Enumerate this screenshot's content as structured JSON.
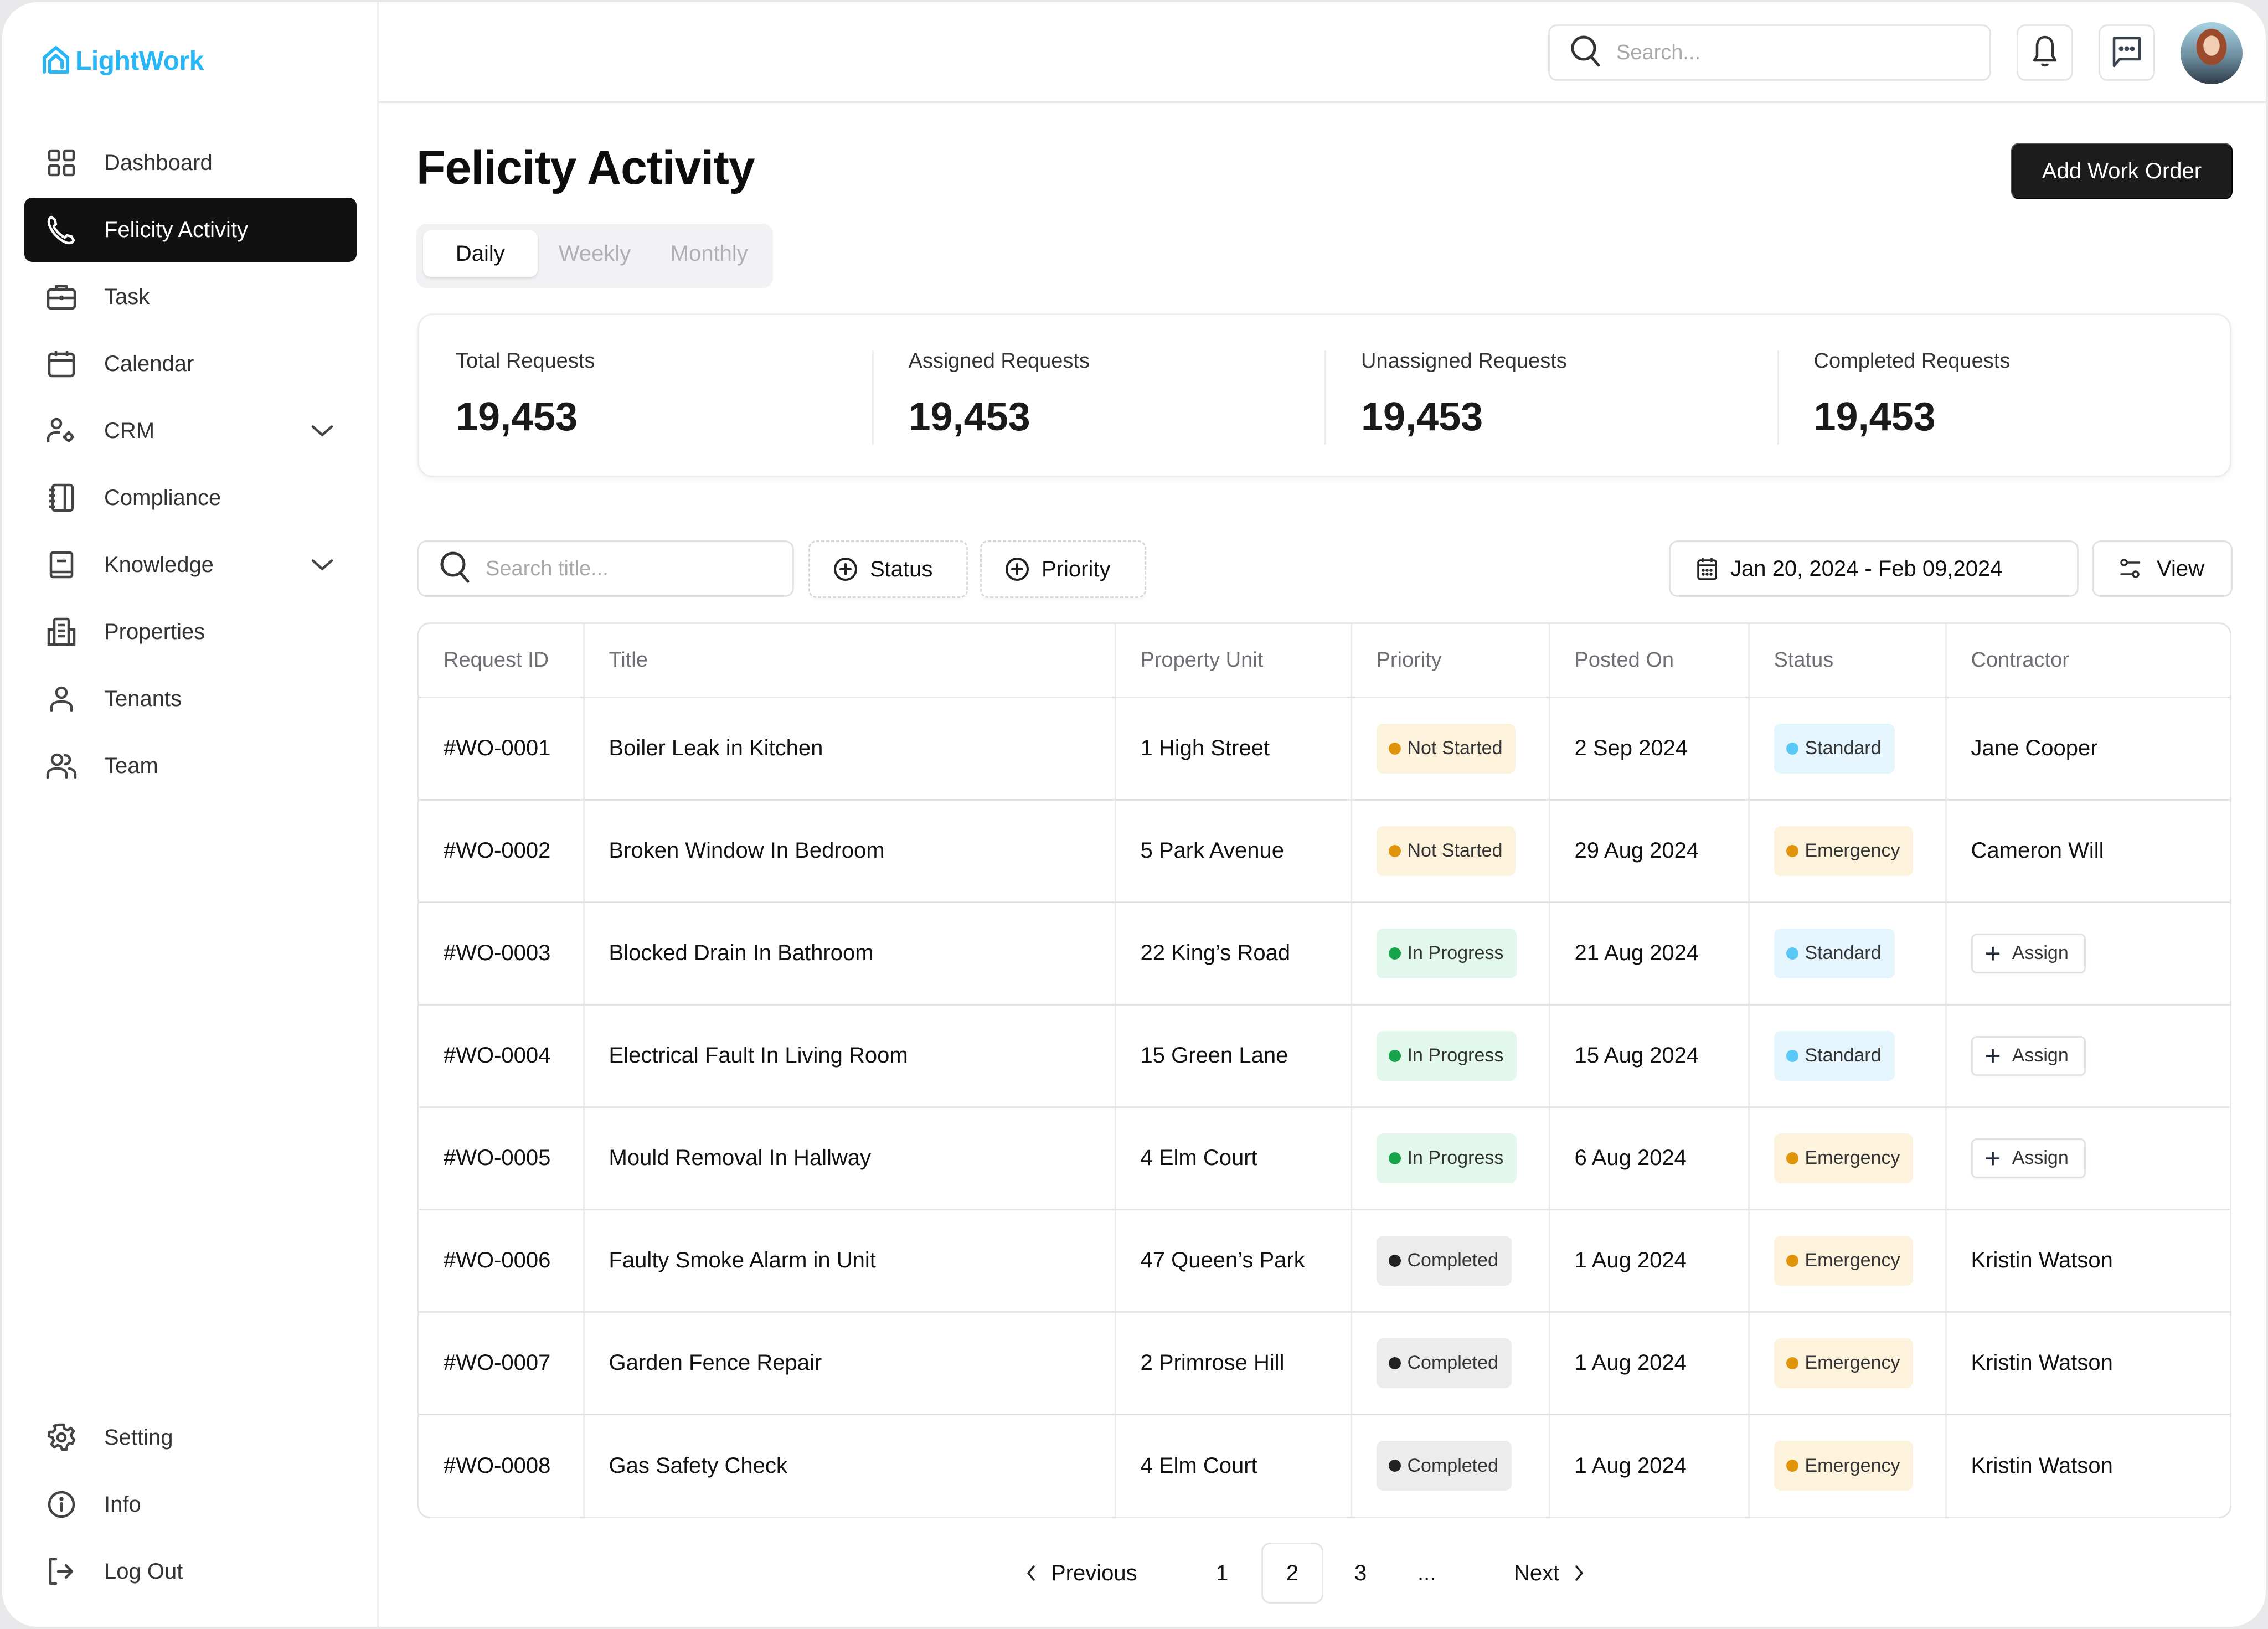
{
  "app": {
    "name": "LightWork",
    "brand_color": "#29b6f6"
  },
  "sidebar": {
    "items": [
      {
        "label": "Dashboard",
        "icon": "grid-icon",
        "active": false
      },
      {
        "label": "Felicity Activity",
        "icon": "phone-icon",
        "active": true
      },
      {
        "label": "Task",
        "icon": "briefcase-icon",
        "active": false
      },
      {
        "label": "Calendar",
        "icon": "calendar-icon",
        "active": false
      },
      {
        "label": "CRM",
        "icon": "user-gear-icon",
        "active": false,
        "expandable": true
      },
      {
        "label": "Compliance",
        "icon": "notebook-icon",
        "active": false
      },
      {
        "label": "Knowledge",
        "icon": "book-icon",
        "active": false,
        "expandable": true
      },
      {
        "label": "Properties",
        "icon": "building-icon",
        "active": false
      },
      {
        "label": "Tenants",
        "icon": "user-icon",
        "active": false
      },
      {
        "label": "Team",
        "icon": "users-icon",
        "active": false
      }
    ],
    "bottom_items": [
      {
        "label": "Setting",
        "icon": "gear-icon"
      },
      {
        "label": "Info",
        "icon": "info-icon"
      },
      {
        "label": "Log Out",
        "icon": "logout-icon"
      }
    ]
  },
  "topbar": {
    "search_placeholder": "Search...",
    "notification_icon": "bell-icon",
    "message_icon": "chat-icon",
    "avatar": "user-avatar"
  },
  "page": {
    "title": "Felicity Activity",
    "add_button": "Add Work Order",
    "tabs": [
      {
        "label": "Daily",
        "active": true
      },
      {
        "label": "Weekly",
        "active": false
      },
      {
        "label": "Monthly",
        "active": false
      }
    ]
  },
  "stats": [
    {
      "label": "Total Requests",
      "value": "19,453"
    },
    {
      "label": "Assigned Requests",
      "value": "19,453"
    },
    {
      "label": "Unassigned Requests",
      "value": "19,453"
    },
    {
      "label": "Completed Requests",
      "value": "19,453"
    }
  ],
  "filters": {
    "search_placeholder": "Search title...",
    "status_label": "Status",
    "priority_label": "Priority",
    "date_range": "Jan 20, 2024 - Feb 09,2024",
    "view_label": "View"
  },
  "table": {
    "columns": [
      "Request ID",
      "Title",
      "Property Unit",
      "Priority",
      "Posted On",
      "Status",
      "Contractor"
    ],
    "assign_label": "Assign",
    "rows": [
      {
        "id": "#WO-0001",
        "title": "Boiler Leak in Kitchen",
        "unit": "1 High Street",
        "priority": "Not Started",
        "posted": "2 Sep 2024",
        "status": "Standard",
        "contractor": "Jane Cooper"
      },
      {
        "id": "#WO-0002",
        "title": "Broken Window In Bedroom",
        "unit": "5 Park Avenue",
        "priority": "Not Started",
        "posted": "29 Aug 2024",
        "status": "Emergency",
        "contractor": "Cameron Will"
      },
      {
        "id": "#WO-0003",
        "title": "Blocked Drain In Bathroom",
        "unit": "22 King’s Road",
        "priority": "In Progress",
        "posted": "21 Aug 2024",
        "status": "Standard",
        "contractor": null
      },
      {
        "id": "#WO-0004",
        "title": "Electrical Fault In Living Room",
        "unit": "15 Green Lane",
        "priority": "In Progress",
        "posted": "15 Aug 2024",
        "status": "Standard",
        "contractor": null
      },
      {
        "id": "#WO-0005",
        "title": "Mould Removal In Hallway",
        "unit": "4 Elm Court",
        "priority": "In Progress",
        "posted": "6 Aug 2024",
        "status": "Emergency",
        "contractor": null
      },
      {
        "id": "#WO-0006",
        "title": "Faulty Smoke Alarm in Unit",
        "unit": "47 Queen’s Park",
        "priority": "Completed",
        "posted": "1 Aug 2024",
        "status": "Emergency",
        "contractor": "Kristin Watson"
      },
      {
        "id": "#WO-0007",
        "title": "Garden Fence Repair",
        "unit": "2 Primrose Hill",
        "priority": "Completed",
        "posted": "1 Aug 2024",
        "status": "Emergency",
        "contractor": "Kristin Watson"
      },
      {
        "id": "#WO-0008",
        "title": "Gas Safety Check",
        "unit": "4 Elm Court",
        "priority": "Completed",
        "posted": "1 Aug 2024",
        "status": "Emergency",
        "contractor": "Kristin Watson"
      }
    ]
  },
  "badge_styles": {
    "Not Started": {
      "bg": "#fdf3dc",
      "dot": "#e0940b"
    },
    "In Progress": {
      "bg": "#e2f8ec",
      "dot": "#16a34a"
    },
    "Completed": {
      "bg": "#ececec",
      "dot": "#222222"
    },
    "Standard": {
      "bg": "#e4f5fd",
      "dot": "#5ac8f5"
    },
    "Emergency": {
      "bg": "#fdf3dc",
      "dot": "#e0940b"
    }
  },
  "pagination": {
    "previous": "Previous",
    "next": "Next",
    "pages": [
      "1",
      "2",
      "3",
      "..."
    ],
    "current": "2"
  }
}
